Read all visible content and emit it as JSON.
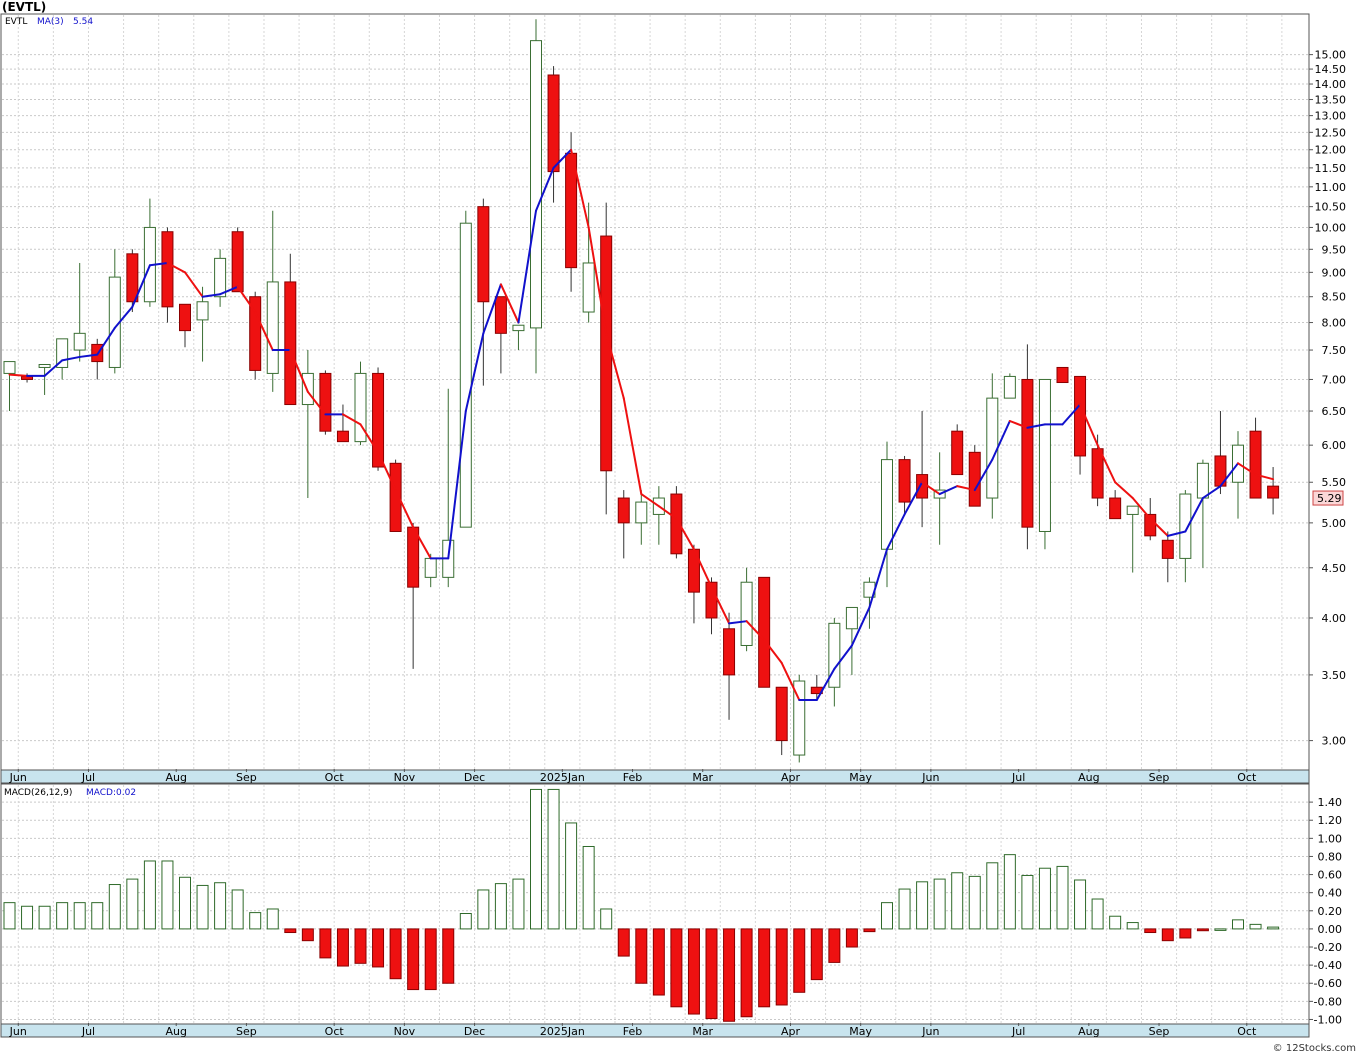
{
  "title": "(EVTL)",
  "legend": {
    "symbol": "EVTL",
    "ma_label": "MA(3)",
    "ma_value": "5.54",
    "macd_label": "MACD(26,12,9)",
    "macd_value": "MACD:0.02"
  },
  "last_price_label": "5.29",
  "credit": "© 12Stocks.com",
  "colors": {
    "up_candle": "#ffffff",
    "up_outline": "#3a6e33",
    "down_candle": "#ee1111",
    "ma_up": "#1111cc",
    "ma_down": "#ee1111",
    "macd_pos": "#2f6a2a",
    "macd_neg": "#ee1111",
    "axis_band": "#c8e4ee",
    "price_tag": "#fbd7d7"
  },
  "chart_data": [
    {
      "type": "candlestick",
      "series_name": "EVTL",
      "y_scale": "log",
      "ylim": [
        2.8,
        16.5
      ],
      "y_ticks": [
        "3.00",
        "3.50",
        "4.00",
        "4.50",
        "5.00",
        "5.50",
        "6.00",
        "6.50",
        "7.00",
        "7.50",
        "8.00",
        "8.50",
        "9.00",
        "9.50",
        "10.00",
        "10.50",
        "11.00",
        "11.50",
        "12.00",
        "12.50",
        "13.00",
        "13.50",
        "14.00",
        "14.50",
        "15.00"
      ],
      "x_labels": [
        "Jun",
        "Jul",
        "Aug",
        "Sep",
        "Oct",
        "Nov",
        "Dec",
        "2025Jan",
        "Feb",
        "Mar",
        "Apr",
        "May",
        "Jun",
        "Jul",
        "Aug",
        "Sep",
        "Oct"
      ],
      "x_label_week_index": [
        0.5,
        4.5,
        9.5,
        13.5,
        18.5,
        22.5,
        26.5,
        31.5,
        35.5,
        39.5,
        44.5,
        48.5,
        52.5,
        57.5,
        61.5,
        65.5,
        70.5
      ],
      "ohlc": [
        [
          7.1,
          7.3,
          6.5,
          7.3
        ],
        [
          7.05,
          7.1,
          6.95,
          7.0
        ],
        [
          7.2,
          7.25,
          6.75,
          7.25
        ],
        [
          7.2,
          7.7,
          7.0,
          7.7
        ],
        [
          7.5,
          9.2,
          7.3,
          7.8
        ],
        [
          7.6,
          7.7,
          7.0,
          7.3
        ],
        [
          7.2,
          9.5,
          7.1,
          8.9
        ],
        [
          9.4,
          9.5,
          8.2,
          8.4
        ],
        [
          8.4,
          10.7,
          8.3,
          10.0
        ],
        [
          9.9,
          10.0,
          8.0,
          8.3
        ],
        [
          8.35,
          8.35,
          7.55,
          7.85
        ],
        [
          8.05,
          8.7,
          7.3,
          8.4
        ],
        [
          8.5,
          9.5,
          8.3,
          9.3
        ],
        [
          9.9,
          10.0,
          8.6,
          8.6
        ],
        [
          8.5,
          8.6,
          7.0,
          7.15
        ],
        [
          7.1,
          10.4,
          6.8,
          8.8
        ],
        [
          8.8,
          9.4,
          6.6,
          6.6
        ],
        [
          6.6,
          7.5,
          5.3,
          7.1
        ],
        [
          7.1,
          7.15,
          6.15,
          6.2
        ],
        [
          6.2,
          6.6,
          6.05,
          6.05
        ],
        [
          6.05,
          7.3,
          6.0,
          7.1
        ],
        [
          7.1,
          7.2,
          5.65,
          5.7
        ],
        [
          5.75,
          5.8,
          4.9,
          4.9
        ],
        [
          4.95,
          5.0,
          3.55,
          4.3
        ],
        [
          4.4,
          4.65,
          4.3,
          4.6
        ],
        [
          4.4,
          6.85,
          4.3,
          4.8
        ],
        [
          4.95,
          10.4,
          4.95,
          10.1
        ],
        [
          10.5,
          10.7,
          6.9,
          8.4
        ],
        [
          8.5,
          8.5,
          7.1,
          7.8
        ],
        [
          7.85,
          7.9,
          7.5,
          7.95
        ],
        [
          7.9,
          16.3,
          7.1,
          15.5
        ],
        [
          14.3,
          14.6,
          10.6,
          11.4
        ],
        [
          11.9,
          12.5,
          8.6,
          9.1
        ],
        [
          8.2,
          10.6,
          8.0,
          9.2
        ],
        [
          9.8,
          10.6,
          5.1,
          5.65
        ],
        [
          5.3,
          5.4,
          4.6,
          5.0
        ],
        [
          5.0,
          5.4,
          4.75,
          5.25
        ],
        [
          5.1,
          5.45,
          4.75,
          5.3
        ],
        [
          5.35,
          5.45,
          4.6,
          4.65
        ],
        [
          4.7,
          4.75,
          3.95,
          4.25
        ],
        [
          4.35,
          4.4,
          3.85,
          4.0
        ],
        [
          3.9,
          4.05,
          3.15,
          3.5
        ],
        [
          3.75,
          4.5,
          3.7,
          4.35
        ],
        [
          4.4,
          4.4,
          3.4,
          3.4
        ],
        [
          3.4,
          3.4,
          2.9,
          3.0
        ],
        [
          2.9,
          3.5,
          2.85,
          3.45
        ],
        [
          3.4,
          3.5,
          3.3,
          3.35
        ],
        [
          3.4,
          4.0,
          3.25,
          3.95
        ],
        [
          3.9,
          4.1,
          3.5,
          4.1
        ],
        [
          4.2,
          4.4,
          3.9,
          4.35
        ],
        [
          4.7,
          6.05,
          4.3,
          5.8
        ],
        [
          5.8,
          5.85,
          5.1,
          5.25
        ],
        [
          5.6,
          6.5,
          4.95,
          5.3
        ],
        [
          5.3,
          5.9,
          4.75,
          5.4
        ],
        [
          6.2,
          6.3,
          5.6,
          5.6
        ],
        [
          5.9,
          6.0,
          5.2,
          5.2
        ],
        [
          5.3,
          7.1,
          5.05,
          6.7
        ],
        [
          6.7,
          7.1,
          6.7,
          7.05
        ],
        [
          7.0,
          7.6,
          4.7,
          4.95
        ],
        [
          4.9,
          7.0,
          4.7,
          7.0
        ],
        [
          7.2,
          7.2,
          6.95,
          6.95
        ],
        [
          7.05,
          7.05,
          5.6,
          5.85
        ],
        [
          5.95,
          6.15,
          5.2,
          5.3
        ],
        [
          5.3,
          5.4,
          5.1,
          5.05
        ],
        [
          5.1,
          5.15,
          4.45,
          5.2
        ],
        [
          5.1,
          5.3,
          4.8,
          4.85
        ],
        [
          4.8,
          4.9,
          4.35,
          4.6
        ],
        [
          4.6,
          5.4,
          4.35,
          5.35
        ],
        [
          5.3,
          5.8,
          4.5,
          5.75
        ],
        [
          5.85,
          6.5,
          5.35,
          5.45
        ],
        [
          5.5,
          6.2,
          5.05,
          6.0
        ],
        [
          6.2,
          6.4,
          5.3,
          5.3
        ],
        [
          5.45,
          5.7,
          5.1,
          5.3
        ]
      ],
      "ma3": [
        7.08,
        7.06,
        7.06,
        7.32,
        7.38,
        7.42,
        7.9,
        8.3,
        9.15,
        9.2,
        9.0,
        8.5,
        8.55,
        8.7,
        8.2,
        7.5,
        7.5,
        6.8,
        6.45,
        6.45,
        6.3,
        5.9,
        5.4,
        4.95,
        4.6,
        4.6,
        6.5,
        7.8,
        8.75,
        8.0,
        10.4,
        11.5,
        12.0,
        10.0,
        7.8,
        6.7,
        5.35,
        5.2,
        5.05,
        4.7,
        4.3,
        3.95,
        3.97,
        3.8,
        3.6,
        3.3,
        3.3,
        3.55,
        3.75,
        4.1,
        4.7,
        5.1,
        5.5,
        5.35,
        5.45,
        5.4,
        5.8,
        6.35,
        6.25,
        6.3,
        6.3,
        6.6,
        6.0,
        5.5,
        5.3,
        5.05,
        4.85,
        4.9,
        5.3,
        5.45,
        5.75,
        5.6,
        5.54
      ]
    },
    {
      "type": "bar",
      "series_name": "MACD(26,12,9)",
      "ylim": [
        -1.05,
        1.6
      ],
      "y_ticks": [
        "-1.00",
        "-0.80",
        "-0.60",
        "-0.40",
        "-0.20",
        "0.00",
        "0.20",
        "0.40",
        "0.60",
        "0.80",
        "1.00",
        "1.20",
        "1.40"
      ],
      "values": [
        0.29,
        0.25,
        0.25,
        0.29,
        0.29,
        0.29,
        0.49,
        0.55,
        0.75,
        0.75,
        0.57,
        0.48,
        0.51,
        0.43,
        0.18,
        0.22,
        -0.04,
        -0.13,
        -0.32,
        -0.41,
        -0.38,
        -0.42,
        -0.55,
        -0.67,
        -0.67,
        -0.6,
        0.17,
        0.43,
        0.5,
        0.55,
        1.54,
        1.54,
        1.17,
        0.91,
        0.22,
        -0.3,
        -0.6,
        -0.73,
        -0.86,
        -0.94,
        -0.99,
        -1.02,
        -0.97,
        -0.86,
        -0.84,
        -0.7,
        -0.56,
        -0.37,
        -0.2,
        -0.03,
        0.29,
        0.44,
        0.52,
        0.55,
        0.62,
        0.58,
        0.73,
        0.82,
        0.59,
        0.67,
        0.69,
        0.54,
        0.33,
        0.14,
        0.07,
        -0.04,
        -0.13,
        -0.1,
        -0.02,
        0.0,
        0.1,
        0.05,
        0.02
      ]
    }
  ]
}
